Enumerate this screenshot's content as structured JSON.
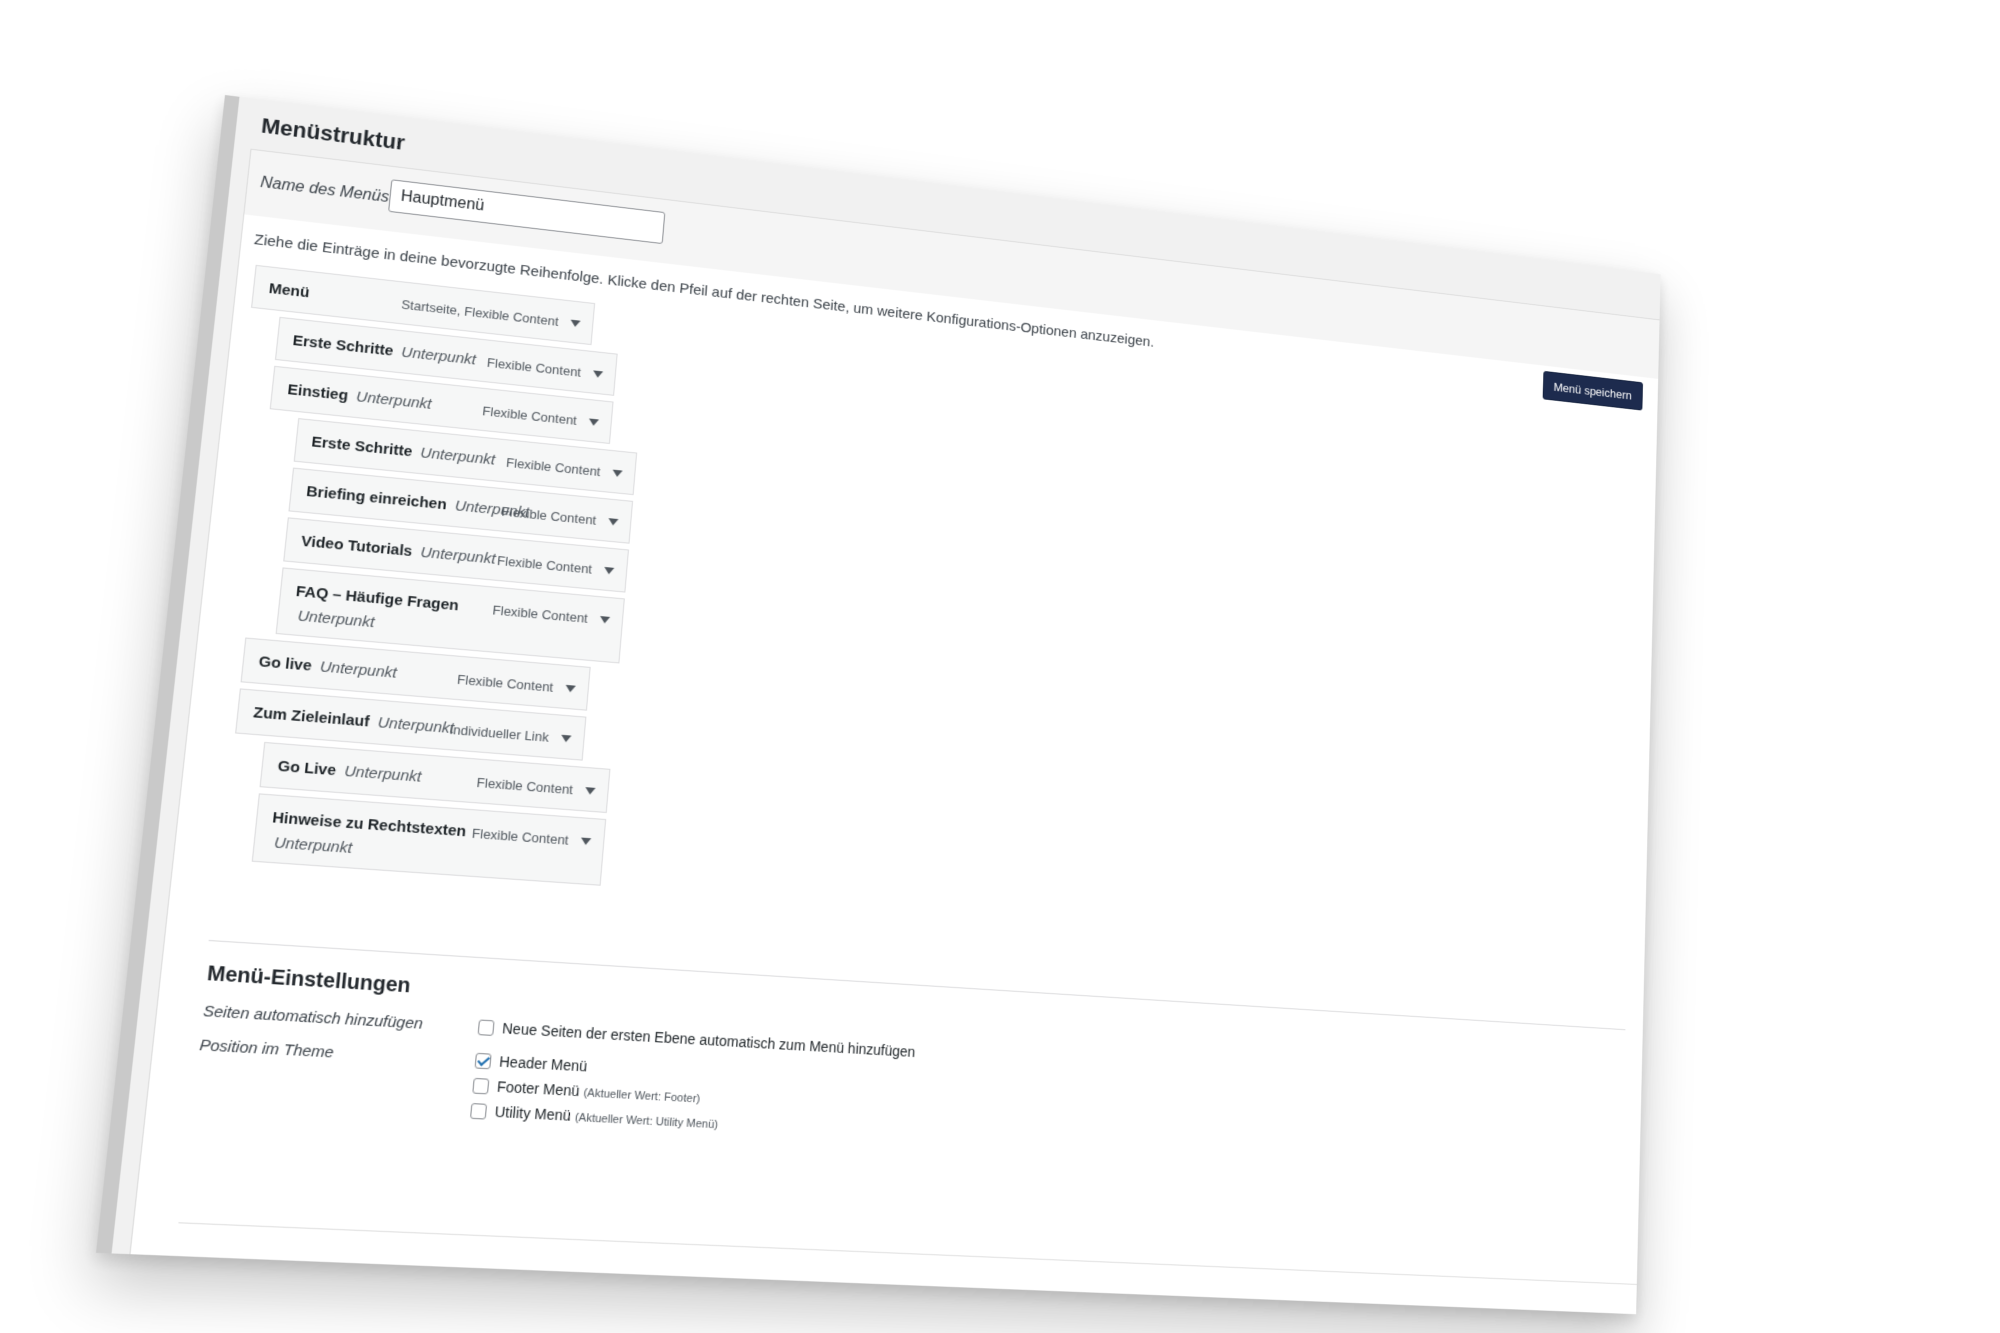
{
  "panel": {
    "title": "Menüstruktur"
  },
  "menu_name": {
    "label": "Name des Menüs",
    "value": "Hauptmenü"
  },
  "instructions": "Ziehe die Einträge in deine bevorzugte Reihenfolge. Klicke den Pfeil auf der rechten Seite, um weitere Konfigurations-Optionen anzuzeigen.",
  "save_label": "Menü speichern",
  "menu_items": [
    {
      "title": "Menü",
      "sub": "",
      "type": "Startseite, Flexible Content"
    },
    {
      "title": "Erste Schritte",
      "sub": "Unterpunkt",
      "type": "Flexible Content"
    },
    {
      "title": "Einstieg",
      "sub": "Unterpunkt",
      "type": "Flexible Content"
    },
    {
      "title": "Erste Schritte",
      "sub": "Unterpunkt",
      "type": "Flexible Content"
    },
    {
      "title": "Briefing einreichen",
      "sub": "Unterpunkt",
      "type": "Flexible Content"
    },
    {
      "title": "Video Tutorials",
      "sub": "Unterpunkt",
      "type": "Flexible Content"
    },
    {
      "title": "FAQ – Häufige Fragen",
      "sub": "Unterpunkt",
      "type": "Flexible Content"
    },
    {
      "title": "Go live",
      "sub": "Unterpunkt",
      "type": "Flexible Content"
    },
    {
      "title": "Zum Zieleinlauf",
      "sub": "Unterpunkt",
      "type": "Individueller Link"
    },
    {
      "title": "Go Live",
      "sub": "Unterpunkt",
      "type": "Flexible Content"
    },
    {
      "title": "Hinweise zu Rechtstexten",
      "sub": "Unterpunkt",
      "type": "Flexible Content"
    }
  ],
  "settings": {
    "title": "Menü-Einstellungen",
    "auto_add_label": "Seiten automatisch hinzufügen",
    "auto_add_option": "Neue Seiten der ersten Ebene automatisch zum Menü hinzufügen",
    "auto_add_checked": false,
    "position_label": "Position im Theme",
    "locations": [
      {
        "label": "Header Menü",
        "note": "",
        "checked": true
      },
      {
        "label": "Footer Menü",
        "note": "(Aktueller Wert: Footer)",
        "checked": false
      },
      {
        "label": "Utility Menü",
        "note": "(Aktueller Wert: Utility Menü)",
        "checked": false
      }
    ]
  }
}
